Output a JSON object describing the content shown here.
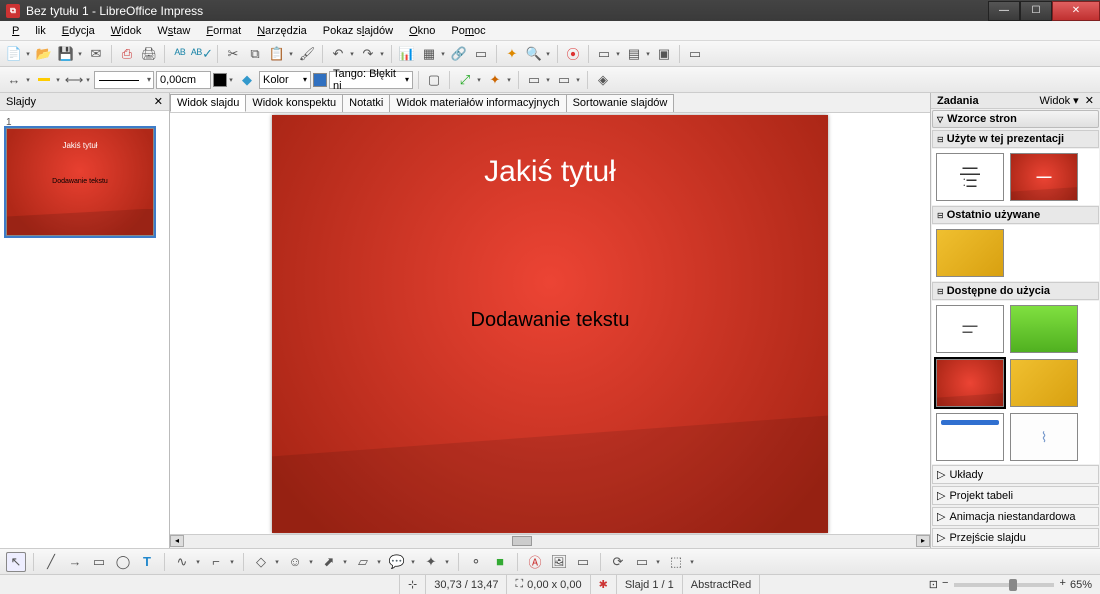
{
  "window": {
    "title": "Bez tytułu 1 - LibreOffice Impress"
  },
  "menu": {
    "file": "Plik",
    "edit": "Edycja",
    "view": "Widok",
    "insert": "Wstaw",
    "format": "Format",
    "tools": "Narzędzia",
    "slideshow": "Pokaz slajdów",
    "window": "Okno",
    "help": "Pomoc"
  },
  "toolbar2": {
    "line_width": "0,00cm",
    "color_label": "Kolor",
    "tango_blue": "Tango: Błękit ni"
  },
  "slides_panel": {
    "title": "Slajdy",
    "thumb_title": "Jakiś tytuł",
    "thumb_body": "Dodawanie tekstu"
  },
  "view_tabs": {
    "normal": "Widok slajdu",
    "outline": "Widok konspektu",
    "notes": "Notatki",
    "handout": "Widok materiałów informacyjnych",
    "sorter": "Sortowanie slajdów"
  },
  "slide": {
    "title": "Jakiś tytuł",
    "body": "Dodawanie tekstu"
  },
  "tasks": {
    "title": "Zadania",
    "view_label": "Widok",
    "master_pages": "Wzorce stron",
    "used_in_pres": "Użyte w tej prezentacji",
    "recent": "Ostatnio używane",
    "available": "Dostępne do użycia",
    "layouts": "Układy",
    "table_design": "Projekt tabeli",
    "custom_anim": "Animacja niestandardowa",
    "slide_trans": "Przejście slajdu"
  },
  "status": {
    "coords": "30,73 / 13,47",
    "size": "0,00 x 0,00",
    "slide": "Slajd 1 / 1",
    "template": "AbstractRed",
    "zoom": "65%"
  }
}
